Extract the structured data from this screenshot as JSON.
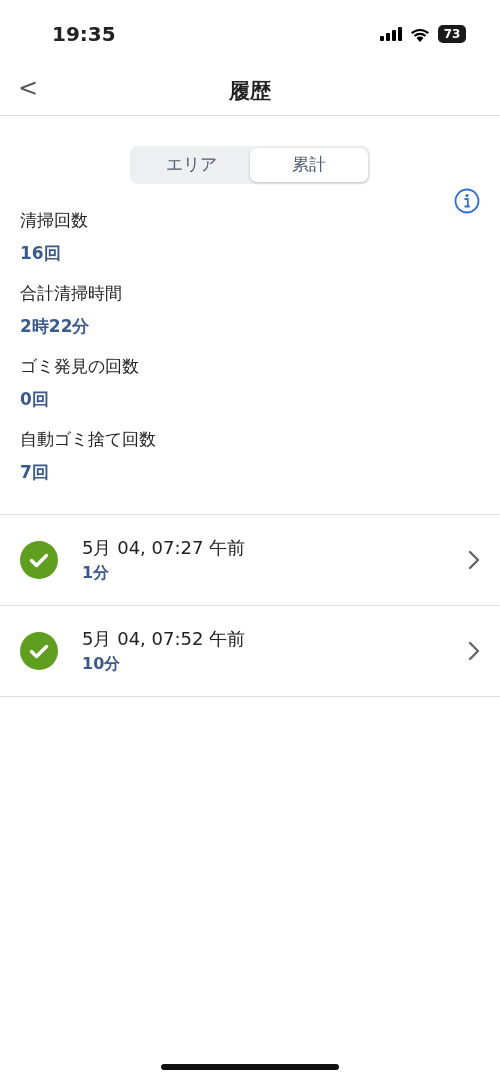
{
  "status_bar": {
    "time": "19:35",
    "battery": "73"
  },
  "header": {
    "back": "<",
    "title": "履歴"
  },
  "segments": [
    {
      "label": "エリア",
      "selected": false
    },
    {
      "label": "累計",
      "selected": true
    }
  ],
  "stats": [
    {
      "label": "清掃回数",
      "value": "16回"
    },
    {
      "label": "合計清掃時間",
      "value": "2時22分"
    },
    {
      "label": "ゴミ発見の回数",
      "value": "0回"
    },
    {
      "label": "自動ゴミ捨て回数",
      "value": "7回"
    }
  ],
  "history": [
    {
      "kind": "completed",
      "datetime": "5月 04, 07:27 午前",
      "duration": "1分"
    },
    {
      "kind": "completed",
      "datetime": "5月 04, 07:52 午前",
      "duration": "10分"
    }
  ]
}
